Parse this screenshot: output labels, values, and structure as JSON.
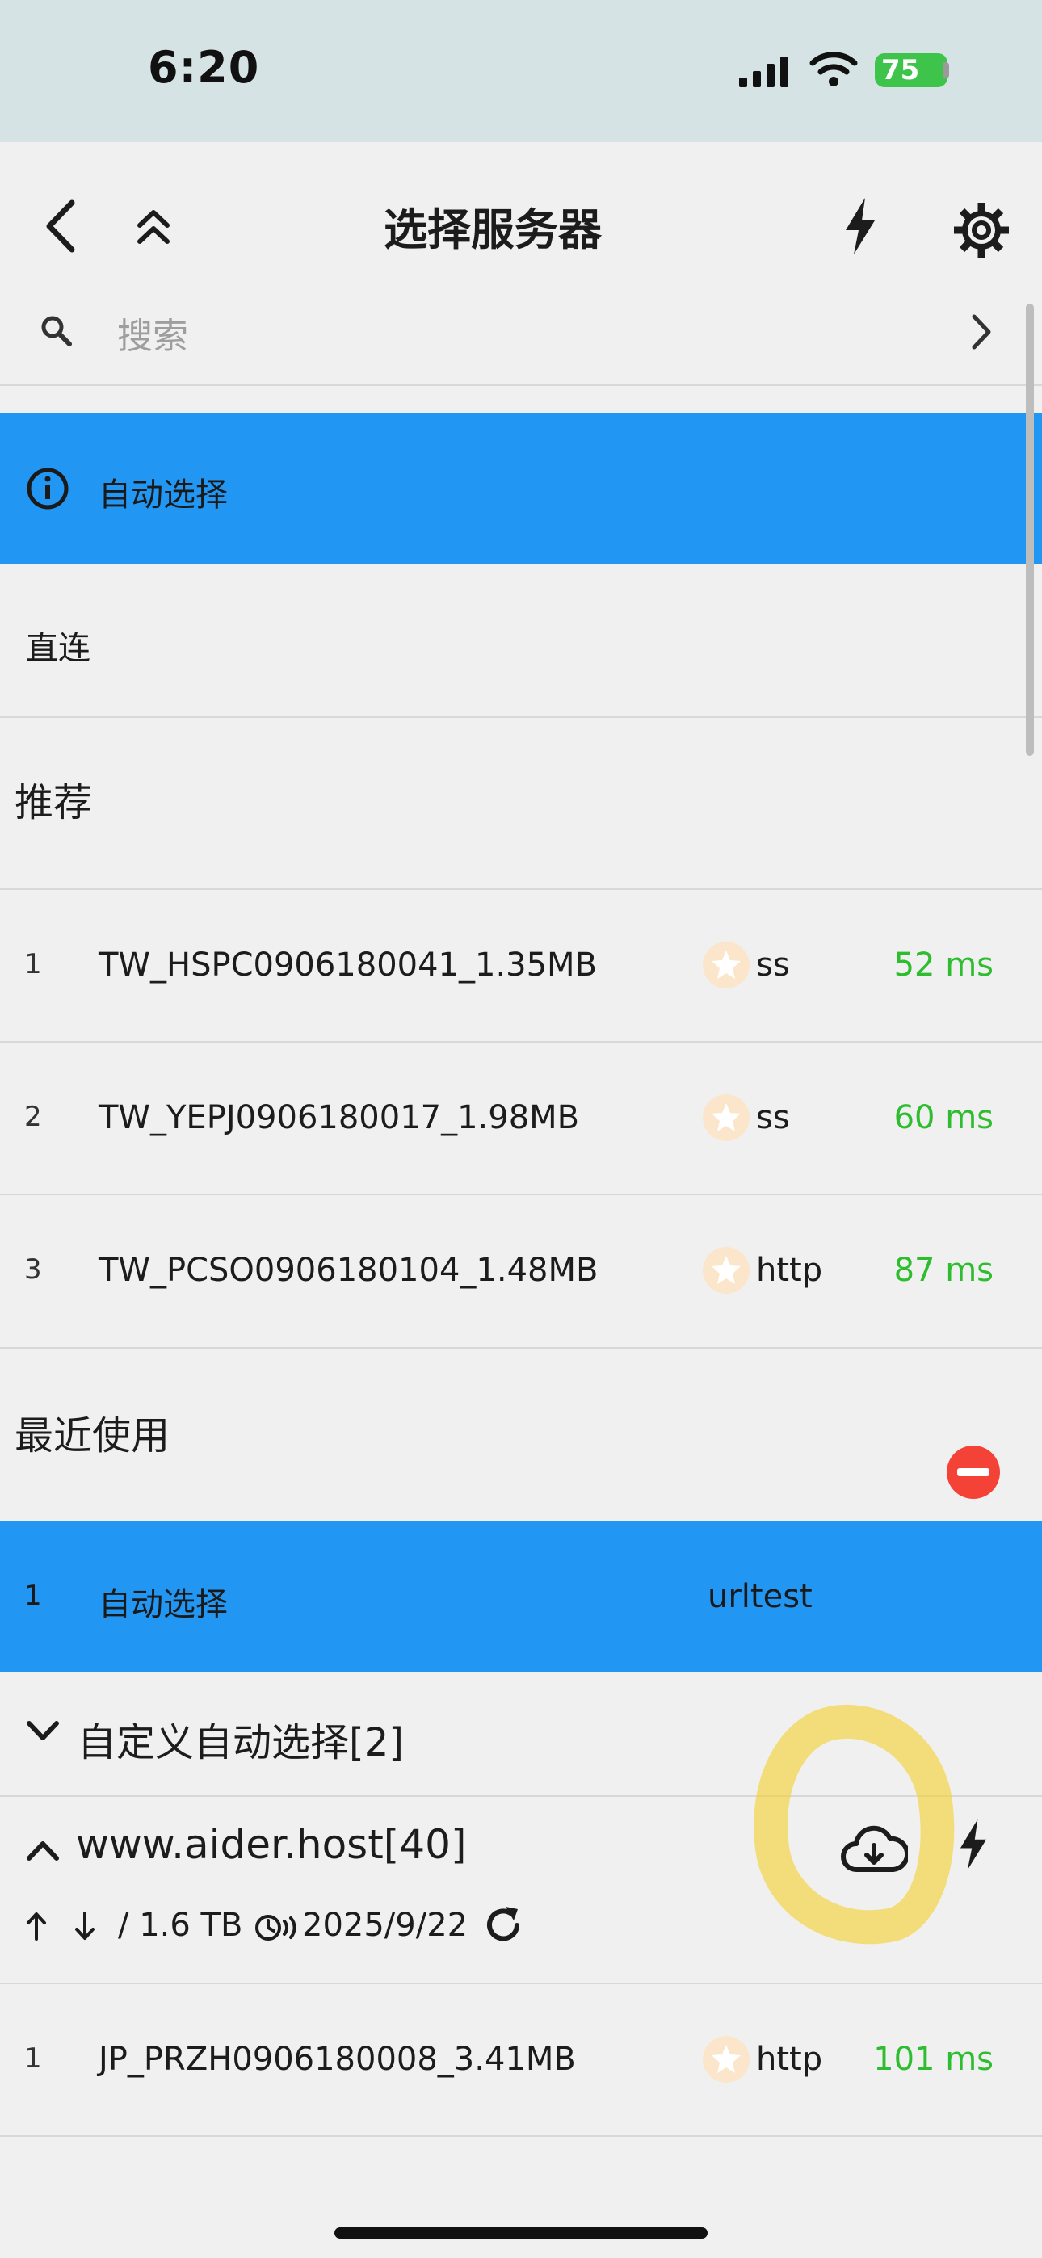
{
  "status_bar": {
    "time": "6:20",
    "battery": "75"
  },
  "nav": {
    "title": "选择服务器"
  },
  "search": {
    "placeholder": "搜索"
  },
  "auto_select": {
    "label": "自动选择"
  },
  "direct": {
    "label": "直连"
  },
  "recommended": {
    "title": "推荐",
    "items": [
      {
        "index": "1",
        "name": "TW_HSPC0906180041_1.35MB",
        "protocol": "ss",
        "latency": "52 ms"
      },
      {
        "index": "2",
        "name": "TW_YEPJ0906180017_1.98MB",
        "protocol": "ss",
        "latency": "60 ms"
      },
      {
        "index": "3",
        "name": "TW_PCSO0906180104_1.48MB",
        "protocol": "http",
        "latency": "87 ms"
      }
    ]
  },
  "recent": {
    "title": "最近使用",
    "items": [
      {
        "index": "1",
        "name": "自动选择",
        "protocol": "urltest"
      }
    ]
  },
  "custom_group": {
    "title": "自定义自动选择[2]"
  },
  "subscription": {
    "title": "www.aider.host[40]",
    "traffic": "/ 1.6 TB",
    "updated": "2025/9/22",
    "items": [
      {
        "index": "1",
        "name": "JP_PRZH0906180008_3.41MB",
        "protocol": "http",
        "latency": "101 ms"
      }
    ]
  },
  "colors": {
    "selected": "#2196f3",
    "latency": "#2ebd2e",
    "delete": "#f44336"
  },
  "icons": [
    "back-icon",
    "collapse-all-icon",
    "lightning-icon",
    "gear-icon",
    "search-icon",
    "chevron-right-icon",
    "info-icon",
    "star-icon",
    "remove-icon",
    "chevron-down-icon",
    "chevron-up-icon",
    "cloud-download-icon",
    "arrow-up-icon",
    "arrow-down-icon",
    "clock-icon",
    "refresh-icon"
  ]
}
